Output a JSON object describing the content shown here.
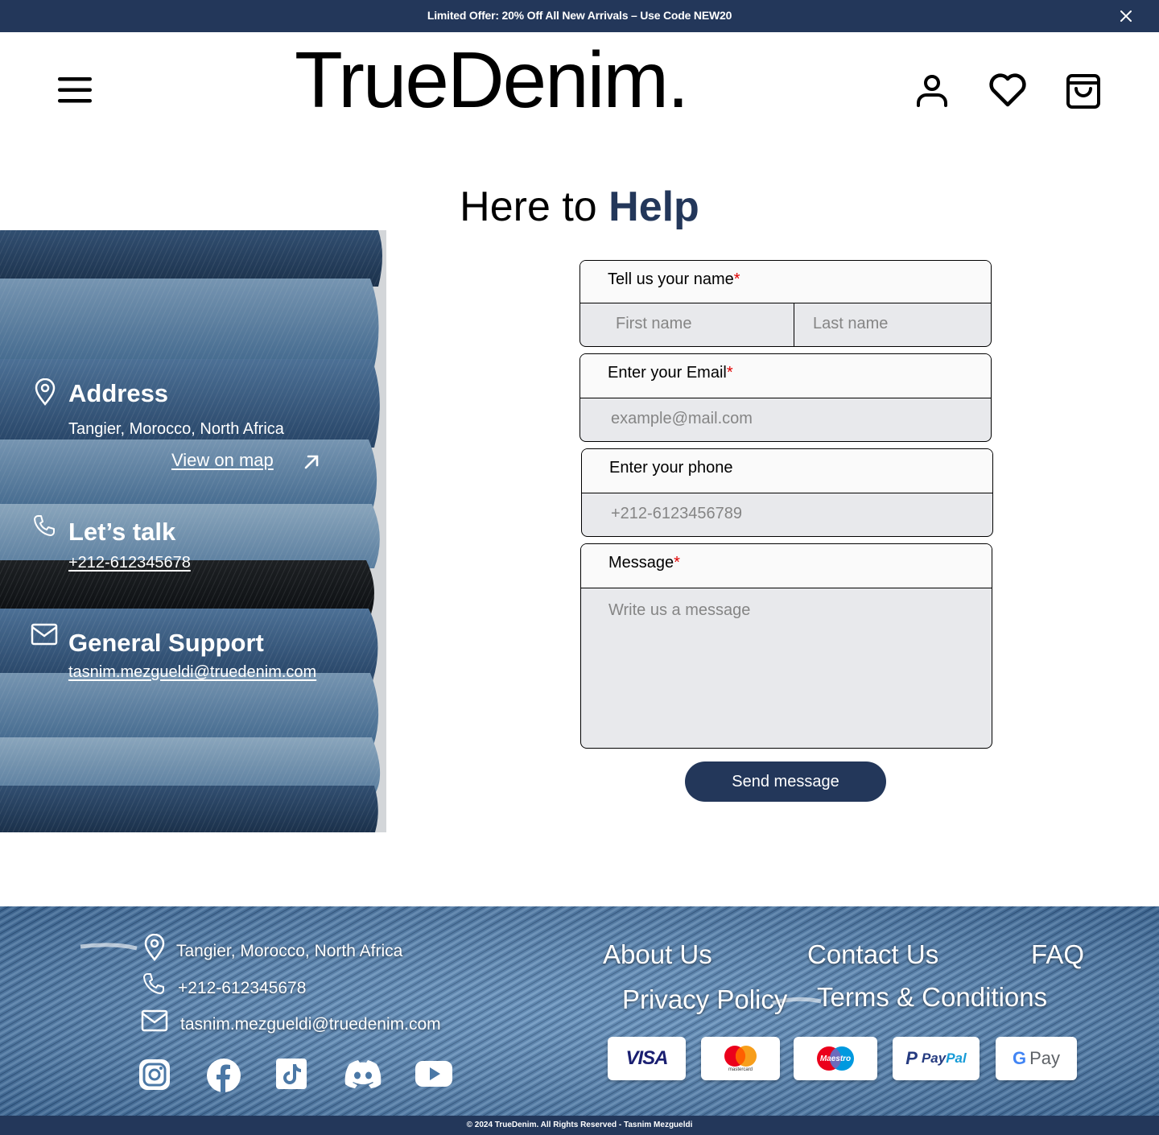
{
  "announcement": {
    "text": "Limited Offer: 20% Off All New Arrivals – Use Code NEW20",
    "close_icon": "close-icon"
  },
  "header": {
    "brand": "TrueDenim.",
    "icons": [
      "menu-icon",
      "user-icon",
      "heart-icon",
      "shopping-bag-icon"
    ]
  },
  "page": {
    "title_plain": "Here to ",
    "title_accent": "Help"
  },
  "info": {
    "address_title": "Address",
    "address_text": "Tangier, Morocco, North Africa",
    "map_link": "View on map",
    "talk_title": "Let’s talk",
    "phone": "+212-612345678",
    "support_title": "General Support",
    "email": "tasnim.mezgueldi@truedenim.com"
  },
  "form": {
    "name_label": "Tell us your name",
    "first_placeholder": "First name",
    "last_placeholder": "Last name",
    "email_label": "Enter your Email",
    "email_placeholder": "example@mail.com",
    "phone_label": "Enter your phone",
    "phone_placeholder": "+212-6123456789",
    "message_label": "Message",
    "message_placeholder": "Write us a message",
    "required_mark": "*",
    "submit": "Send message"
  },
  "footer": {
    "address": "Tangier, Morocco, North Africa",
    "phone": "+212-612345678",
    "email": "tasnim.mezgueldi@truedenim.com",
    "links": {
      "about": "About Us",
      "contact": "Contact Us",
      "faq": "FAQ",
      "privacy": "Privacy Policy",
      "terms": "Terms & Conditions"
    },
    "payments": {
      "visa": "VISA",
      "mastercard": "mastercard",
      "maestro": "Maestro",
      "paypal_a": "Pay",
      "paypal_b": "Pal",
      "gpay": "Pay"
    },
    "social_icons": [
      "instagram-icon",
      "facebook-icon",
      "tiktok-icon",
      "discord-icon",
      "youtube-icon"
    ],
    "copyright": "© 2024 TrueDenim. All Rights Reserved - Tasnim Mezgueldi"
  },
  "colors": {
    "navy": "#23375a",
    "required": "#e00000",
    "field_bg": "#e8e9ec",
    "denim": "#4f7ba8"
  }
}
